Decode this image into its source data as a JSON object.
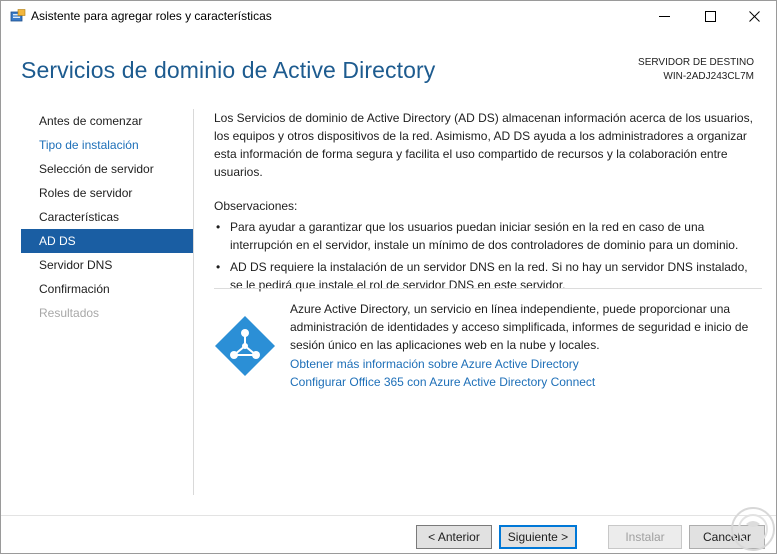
{
  "window": {
    "title": "Asistente para agregar roles y características",
    "controls": {
      "minimize": "—",
      "maximize": "☐",
      "close": "✕"
    }
  },
  "header": {
    "page_title": "Servicios de dominio de Active Directory",
    "destination_label": "SERVIDOR DE DESTINO",
    "destination_server": "WIN-2ADJ243CL7M"
  },
  "nav": {
    "items": [
      {
        "label": "Antes de comenzar",
        "state": "normal"
      },
      {
        "label": "Tipo de instalación",
        "state": "link"
      },
      {
        "label": "Selección de servidor",
        "state": "normal"
      },
      {
        "label": "Roles de servidor",
        "state": "normal"
      },
      {
        "label": "Características",
        "state": "normal"
      },
      {
        "label": "AD DS",
        "state": "active"
      },
      {
        "label": "Servidor DNS",
        "state": "normal"
      },
      {
        "label": "Confirmación",
        "state": "normal"
      },
      {
        "label": "Resultados",
        "state": "disabled"
      }
    ]
  },
  "content": {
    "intro": "Los Servicios de dominio de Active Directory (AD DS) almacenan información acerca de los usuarios, los equipos y otros dispositivos de la red. Asimismo, AD DS ayuda a los administradores a organizar esta información de forma segura y facilita el uso compartido de recursos y la colaboración entre usuarios.",
    "observations_title": "Observaciones:",
    "bullets": [
      "Para ayudar a garantizar que los usuarios puedan iniciar sesión en la red en caso de una interrupción en el servidor, instale un mínimo de dos controladores de dominio para un dominio.",
      "AD DS requiere la instalación de un servidor DNS en la red. Si no hay un servidor DNS instalado, se le pedirá que instale el rol de servidor DNS en este servidor."
    ],
    "bullet_glyph": "•"
  },
  "azure": {
    "description": "Azure Active Directory, un servicio en línea independiente, puede proporcionar una administración de identidades y acceso simplificada, informes de seguridad e inicio de sesión único en las aplicaciones web en la nube y locales.",
    "link_more_info": "Obtener más información sobre Azure Active Directory",
    "link_configure": "Configurar Office 365 con Azure Active Directory Connect",
    "icon": "azure-ad-diamond-icon"
  },
  "footer": {
    "prev_label": "< Anterior",
    "next_label": "Siguiente >",
    "install_label": "Instalar",
    "cancel_label": "Cancelar"
  },
  "colors": {
    "title_blue": "#1d5b8f",
    "link_blue": "#1d6fb8",
    "nav_active_bg": "#1a5ea3",
    "azure_blue": "#2b8fd6",
    "disabled_gray": "#a8a8a8"
  }
}
